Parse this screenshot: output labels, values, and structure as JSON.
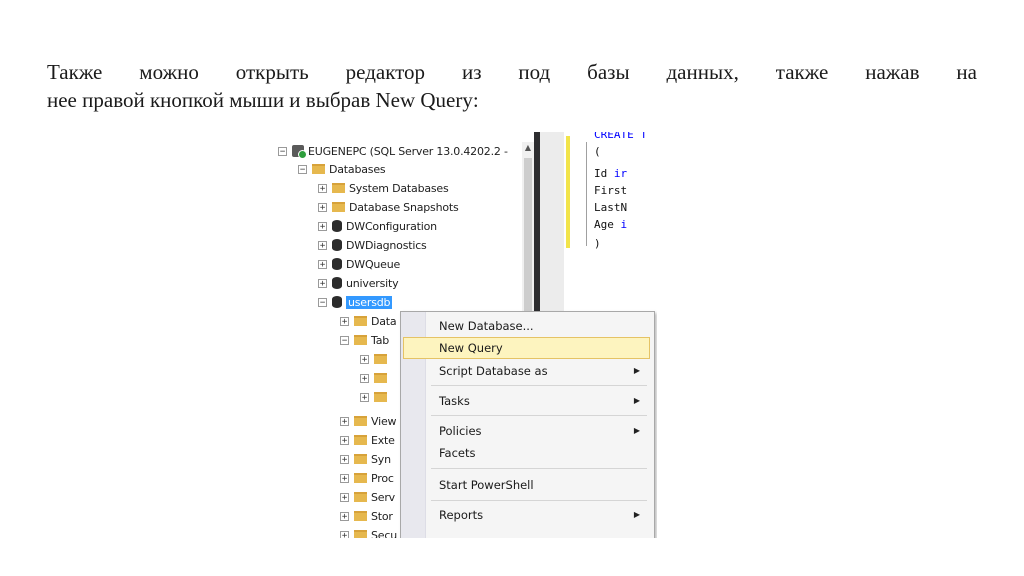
{
  "paragraph": {
    "line1": "Также можно открыть редактор из под базы данных, также нажав на",
    "line2": "нее правой кнопкой мыши и выбрав New Query:"
  },
  "tree": {
    "server": "EUGENEPC (SQL Server 13.0.4202.2 -",
    "databases": "Databases",
    "system_databases": "System Databases",
    "database_snapshots": "Database Snapshots",
    "db1": "DWConfiguration",
    "db2": "DWDiagnostics",
    "db3": "DWQueue",
    "db4": "university",
    "db5": "usersdb",
    "children": [
      "Data",
      "Tab",
      "",
      "",
      "",
      "View",
      "Exte",
      "Syn",
      "Proc",
      "Serv",
      "Stor",
      "Secu"
    ],
    "expanders": {
      "expand": "+",
      "collapse": "−"
    }
  },
  "editor": {
    "lines": [
      {
        "plain": "",
        "keyword": "CREATE T"
      },
      {
        "plain": "(",
        "keyword": ""
      },
      {
        "plain": "    Id ",
        "keyword": "ir"
      },
      {
        "plain": "    First",
        "keyword": ""
      },
      {
        "plain": "    LastN",
        "keyword": ""
      },
      {
        "plain": "    Age ",
        "keyword": "i"
      },
      {
        "plain": ")",
        "keyword": ""
      }
    ]
  },
  "context_menu": {
    "items": [
      {
        "label": "New Database...",
        "arrow": ""
      },
      {
        "label": "New Query",
        "arrow": ""
      },
      {
        "label": "Script Database as",
        "arrow": "▶"
      },
      {
        "label": "Tasks",
        "arrow": "▶"
      },
      {
        "label": "Policies",
        "arrow": "▶"
      },
      {
        "label": "Facets",
        "arrow": ""
      },
      {
        "label": "Start PowerShell",
        "arrow": ""
      },
      {
        "label": "Reports",
        "arrow": "▶"
      }
    ],
    "highlighted": "New Query"
  },
  "icons": {
    "server": "server-icon",
    "folder": "folder-icon",
    "database": "database-icon",
    "scroll_up": "▲"
  },
  "colors": {
    "selection": "#3399ff",
    "menu_highlight": "#fdf4bf",
    "folder": "#e6b84e",
    "keyword": "#0000ff"
  }
}
